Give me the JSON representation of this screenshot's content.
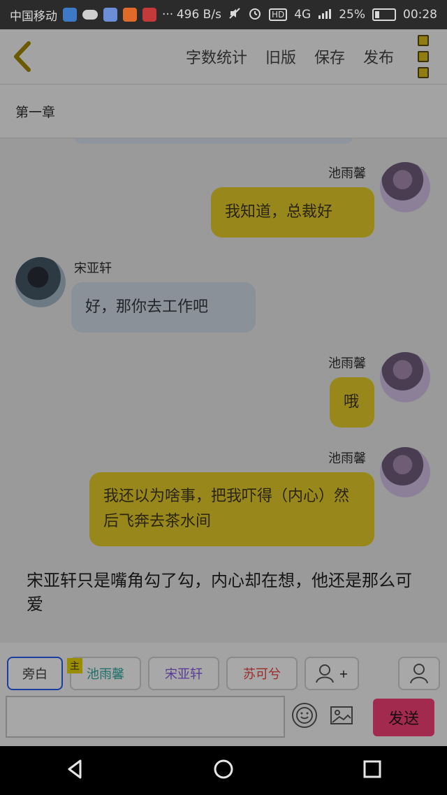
{
  "status_bar": {
    "carrier": "中国移动",
    "speed": "496 B/s",
    "battery": "25%",
    "time": "00:28",
    "hd": "HD",
    "network": "4G",
    "dots": "···"
  },
  "appbar": {
    "menu": [
      "字数统计",
      "旧版",
      "保存",
      "发布"
    ]
  },
  "chapter_title": "第一章",
  "messages": [
    {
      "side": "right",
      "sender": "池雨馨",
      "text": "我知道，总裁好"
    },
    {
      "side": "left",
      "sender": "宋亚轩",
      "text": "好，那你去工作吧"
    },
    {
      "side": "right",
      "sender": "池雨馨",
      "text": "哦"
    },
    {
      "side": "right",
      "sender": "池雨馨",
      "text": "我还以为啥事，把我吓得（内心）然后飞奔去茶水间"
    }
  ],
  "narration": "宋亚轩只是嘴角勾了勾，内心却在想，他还是那么可爱",
  "roles": {
    "narrator": "旁白",
    "main_tag": "主",
    "role1": "池雨馨",
    "role2": "宋亚轩",
    "role3": "苏可兮",
    "add_symbol": "+"
  },
  "input": {
    "placeholder": "",
    "send_label": "发送"
  },
  "colors": {
    "yellow_bubble": "#98881c",
    "gray_bubble": "#8a9198",
    "send": "#a22a4f",
    "role1_text": "#1f6f6a",
    "role2_text": "#5a3c93",
    "role3_text": "#9b2b2b"
  }
}
